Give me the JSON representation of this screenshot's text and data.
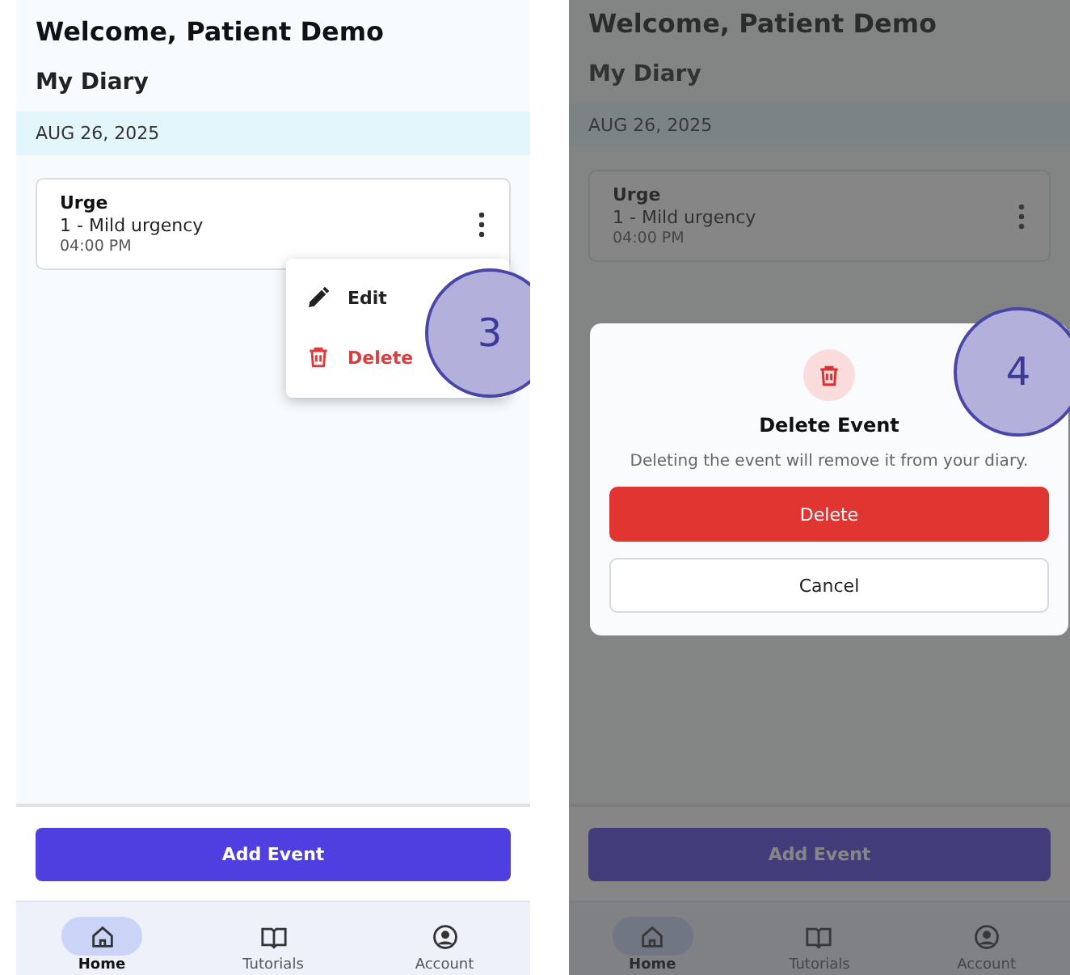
{
  "screens": [
    {
      "annotation": "3",
      "welcome": "Welcome, Patient Demo",
      "diary_title": "My Diary",
      "date": "AUG 26, 2025",
      "events": [
        {
          "title": "Urge",
          "detail": "1 - Mild urgency",
          "time": "04:00 PM"
        }
      ],
      "menu": {
        "items": [
          {
            "kind": "edit",
            "label": "Edit"
          },
          {
            "kind": "delete",
            "label": "Delete"
          }
        ]
      },
      "add_button": "Add Event",
      "nav": [
        {
          "kind": "home",
          "label": "Home",
          "selected": true
        },
        {
          "kind": "book",
          "label": "Tutorials",
          "selected": false
        },
        {
          "kind": "account",
          "label": "Account",
          "selected": false
        }
      ]
    },
    {
      "annotation": "4",
      "welcome": "Welcome, Patient Demo",
      "diary_title": "My Diary",
      "date": "AUG 26, 2025",
      "events": [
        {
          "title": "Urge",
          "detail": "1 - Mild urgency",
          "time": "04:00 PM"
        }
      ],
      "dialog": {
        "title": "Delete Event",
        "message": "Deleting the event will remove it from your diary.",
        "buttons": [
          {
            "kind": "danger",
            "label": "Delete"
          },
          {
            "kind": "plain",
            "label": "Cancel"
          }
        ]
      },
      "add_button": "Add Event",
      "nav": [
        {
          "kind": "home",
          "label": "Home",
          "selected": true
        },
        {
          "kind": "book",
          "label": "Tutorials",
          "selected": false
        },
        {
          "kind": "account",
          "label": "Account",
          "selected": false
        }
      ]
    }
  ]
}
